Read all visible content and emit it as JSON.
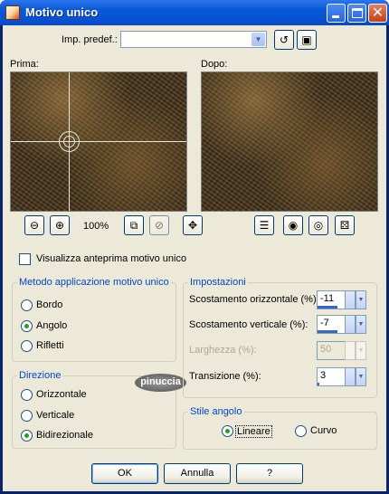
{
  "window": {
    "title": "Motivo unico"
  },
  "preset": {
    "label": "Imp. predef.:",
    "value": ""
  },
  "previews": {
    "before_label": "Prima:",
    "after_label": "Dopo:"
  },
  "zoom": {
    "level": "100%"
  },
  "checkbox": {
    "label": "Visualizza anteprima motivo unico",
    "checked": false
  },
  "method": {
    "title": "Metodo applicazione motivo unico",
    "options": [
      {
        "label": "Bordo",
        "selected": false
      },
      {
        "label": "Angolo",
        "selected": true
      },
      {
        "label": "Rifletti",
        "selected": false
      }
    ]
  },
  "direction": {
    "title": "Direzione",
    "options": [
      {
        "label": "Orizzontale",
        "selected": false
      },
      {
        "label": "Verticale",
        "selected": false
      },
      {
        "label": "Bidirezionale",
        "selected": true
      }
    ]
  },
  "settings": {
    "title": "Impostazioni",
    "fields": [
      {
        "label": "Scostamento orizzontale (%):",
        "value": "-11",
        "enabled": true
      },
      {
        "label": "Scostamento verticale (%):",
        "value": "-7",
        "enabled": true
      },
      {
        "label": "Larghezza (%):",
        "value": "50",
        "enabled": false
      },
      {
        "label": "Transizione (%):",
        "value": "3",
        "enabled": true
      }
    ]
  },
  "corner_style": {
    "title": "Stile angolo",
    "options": [
      {
        "label": "Lineare",
        "selected": true
      },
      {
        "label": "Curvo",
        "selected": false
      }
    ]
  },
  "watermark": {
    "text": "pinuccia"
  },
  "buttons": {
    "ok": "OK",
    "cancel": "Annulla",
    "help": "?"
  },
  "icons": {
    "zoom_out": "zoom-out-icon",
    "zoom_in": "zoom-in-icon",
    "fit": "fit-window-icon",
    "zoom_disabled": "zoom-disabled-icon",
    "pan": "move-icon",
    "list": "list-icon",
    "eye_lock": "eye-lock-icon",
    "eye": "eye-icon",
    "random": "dice-icon",
    "reset": "reset-icon",
    "save": "save-icon"
  }
}
